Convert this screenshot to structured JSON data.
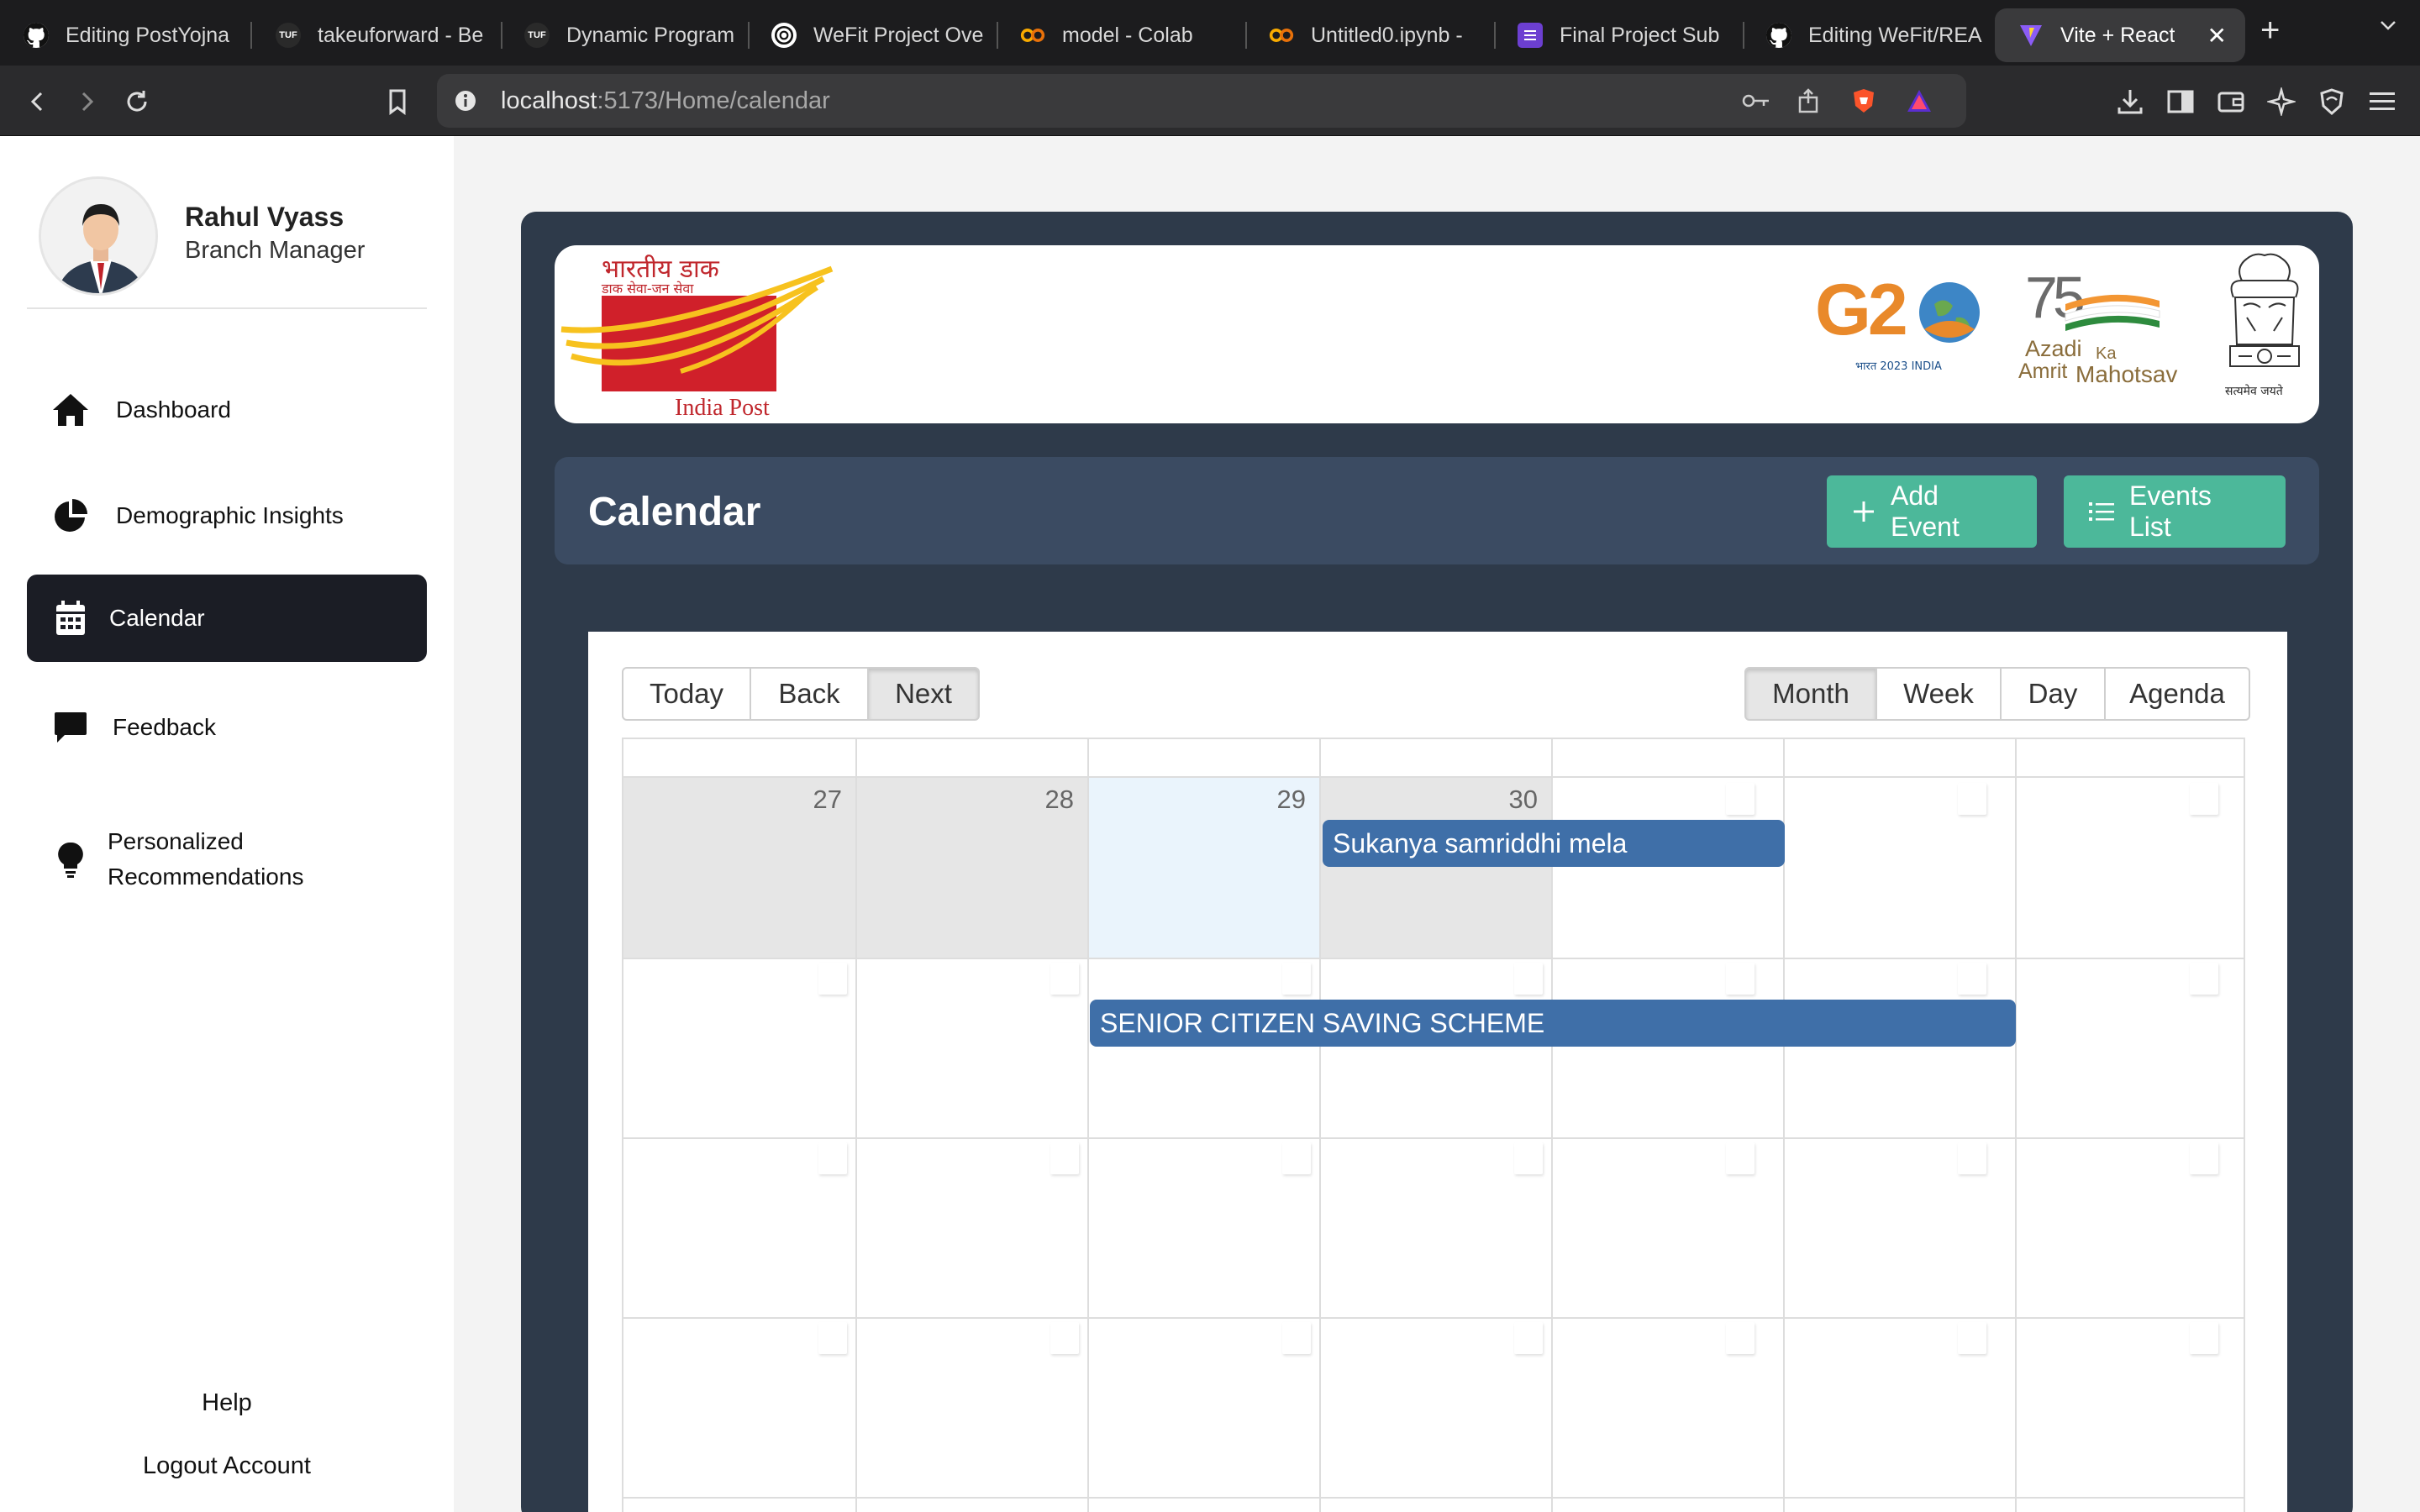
{
  "browser": {
    "tabs": [
      {
        "label": "Editing PostYojna",
        "icon": "github-icon"
      },
      {
        "label": "takeuforward - Be",
        "icon": "tuf-icon"
      },
      {
        "label": "Dynamic Program",
        "icon": "tuf-icon"
      },
      {
        "label": "WeFit Project Ove",
        "icon": "openai-icon"
      },
      {
        "label": "model - Colab",
        "icon": "colab-icon"
      },
      {
        "label": "Untitled0.ipynb -",
        "icon": "colab-icon"
      },
      {
        "label": "Final Project Sub",
        "icon": "list-doc-icon"
      },
      {
        "label": "Editing WeFit/REA",
        "icon": "github-icon"
      },
      {
        "label": "Vite + React",
        "icon": "vite-icon"
      }
    ],
    "url_host": "localhost",
    "url_path": ":5173/Home/calendar",
    "colors": {
      "tab_bar": "#1c1c1e",
      "toolbar": "#2b2b2d"
    }
  },
  "sidebar": {
    "profile": {
      "name": "Rahul Vyass",
      "role": "Branch Manager"
    },
    "items": [
      {
        "label": "Dashboard",
        "icon": "home-icon"
      },
      {
        "label": "Demographic Insights",
        "icon": "pie-chart-icon"
      },
      {
        "label": "Calendar",
        "icon": "calendar-icon",
        "active": true
      },
      {
        "label": "Feedback",
        "icon": "chat-bubble-icon"
      },
      {
        "label": "Personalized Recommendations",
        "icon": "lightbulb-icon"
      }
    ],
    "help": "Help",
    "logout": "Logout Account"
  },
  "banner": {
    "india_post_hindi": "भारतीय डाक",
    "india_post_tagline": "डाक सेवा-जन सेवा",
    "india_post_name": "India Post",
    "g20_caption": "भारत 2023 INDIA",
    "azadi_line1": "Azadi",
    "azadi_ka": "Ka",
    "azadi_line2": "Amrit",
    "azadi_line3": "Mahotsav",
    "emblem_motto": "सत्यमेव जयते"
  },
  "header": {
    "title": "Calendar",
    "add_event": "Add Event",
    "events_list": "Events List",
    "colors": {
      "panel": "#2e3a4a",
      "header": "#3b4b62",
      "button": "#4cb89a"
    }
  },
  "calendar": {
    "nav": {
      "today": "Today",
      "back": "Back",
      "next": "Next"
    },
    "views": {
      "month": "Month",
      "week": "Week",
      "day": "Day",
      "agenda": "Agenda"
    },
    "active_view": "Month",
    "visible_dates": [
      "27",
      "28",
      "29",
      "30"
    ],
    "events": [
      {
        "title": "Sukanya samriddhi mela"
      },
      {
        "title": "SENIOR CITIZEN SAVING SCHEME"
      }
    ],
    "colors": {
      "event": "#3f6fa8",
      "today_highlight": "#eaf4fc",
      "off_range": "#e6e6e6"
    }
  }
}
